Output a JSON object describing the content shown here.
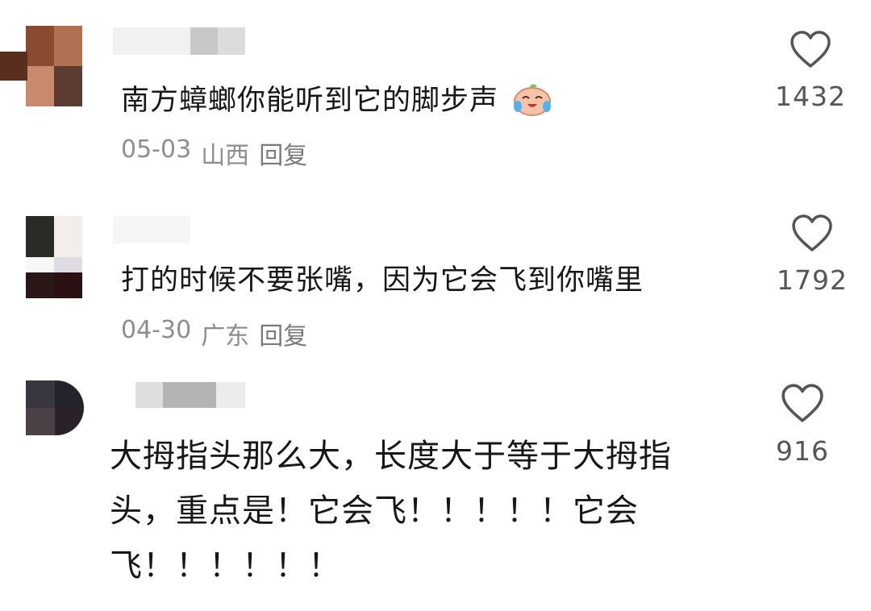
{
  "comments": [
    {
      "text": "南方蟑螂你能听到它的脚步声",
      "emoji": "crying-laughing-emoji",
      "date": "05-03",
      "location": "山西",
      "reply_label": "回复",
      "likes": "1432",
      "avatar_colors": [
        "#8a4a30",
        "#b06a4a",
        "#c8886a",
        "#5a3a2e"
      ]
    },
    {
      "text": "打的时候不要张嘴，因为它会飞到你嘴里",
      "date": "04-30",
      "location": "广东",
      "reply_label": "回复",
      "likes": "1792",
      "avatar_colors": [
        "#2a2a26",
        "#f4eeea",
        "#f7f7f7",
        "#e2e0e4"
      ]
    },
    {
      "text": "大拇指头那么大，长度大于等于大拇指头，重点是！它会飞！！！！！它会飞！！！！！！",
      "likes": "916",
      "avatar_colors": [
        "#3a3640",
        "#24222a",
        "#4a4046",
        "#2a2228"
      ]
    }
  ],
  "icons": {
    "like": "heart-outline-icon"
  }
}
